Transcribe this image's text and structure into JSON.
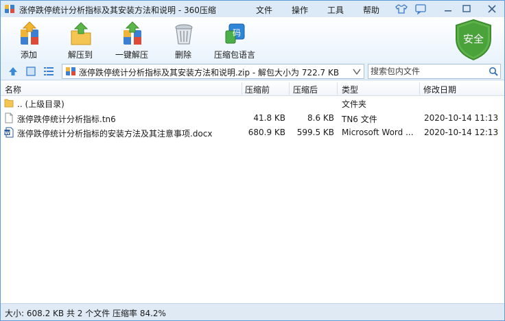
{
  "window": {
    "title": "涨停跌停统计分析指标及其安装方法和说明 - 360压缩"
  },
  "menu": {
    "file": "文件",
    "operate": "操作",
    "tools": "工具",
    "help": "帮助"
  },
  "toolbar": {
    "add": "添加",
    "extract_to": "解压到",
    "one_click_extract": "一键解压",
    "delete": "删除",
    "language": "压缩包语言",
    "security_badge": "安全",
    "language_icon_char": "码"
  },
  "addressbar": {
    "path": "涨停跌停统计分析指标及其安装方法和说明.zip - 解包大小为 722.7 KB",
    "search_placeholder": "搜索包内文件"
  },
  "columns": {
    "name": "名称",
    "compressed": "压缩前",
    "packed": "压缩后",
    "type": "类型",
    "modified": "修改日期"
  },
  "files": [
    {
      "name": ".. (上级目录)",
      "size": "",
      "packed": "",
      "type": "文件夹",
      "modified": "",
      "icon": "folder-icon"
    },
    {
      "name": "涨停跌停统计分析指标.tn6",
      "size": "41.8 KB",
      "packed": "8.6 KB",
      "type": "TN6 文件",
      "modified": "2020-10-14 11:13",
      "icon": "file-icon"
    },
    {
      "name": "涨停跌停统计分析指标的安装方法及其注意事项.docx",
      "size": "680.9 KB",
      "packed": "599.5 KB",
      "type": "Microsoft Word ...",
      "modified": "2020-10-14 12:13",
      "icon": "word-doc-icon"
    }
  ],
  "status": {
    "text": "大小: 608.2 KB 共 2 个文件 压缩率 84.2%"
  },
  "colors": {
    "accent": "#3b8ad8",
    "security_green": "#4aa23a",
    "titlebar": "#dceaf7"
  }
}
